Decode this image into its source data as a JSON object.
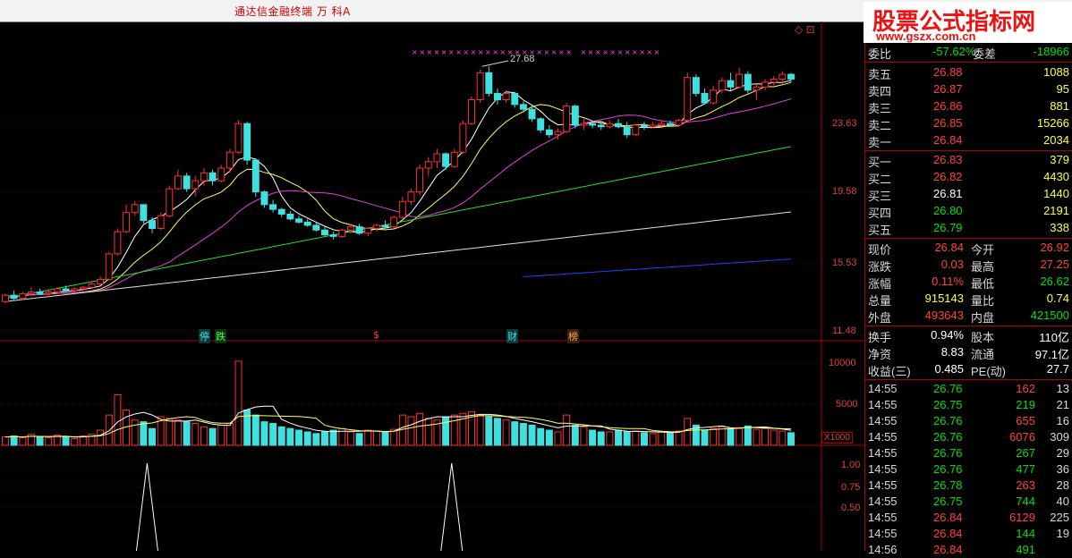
{
  "app": {
    "title": "通达信金融终端    万  科A"
  },
  "watermark": {
    "line1": "股票公式指标网",
    "line2": "www.gszx.com.cn"
  },
  "chart": {
    "corner_icons": "◇ ⊡",
    "max_annotation": "27.68",
    "price_axis": [
      "23.63",
      "19.58",
      "15.53",
      "11.48"
    ],
    "volume_axis": [
      "10000",
      "5000"
    ],
    "volume_unit": "X1000",
    "indicator_axis": [
      "1.00",
      "0.75",
      "0.50"
    ],
    "events": [
      {
        "label": "停",
        "color": "#40e0e0"
      },
      {
        "label": "跌",
        "color": "#40ff40"
      },
      {
        "label": "$",
        "color": "#ff4040"
      },
      {
        "label": "财",
        "color": "#40e0e0"
      },
      {
        "label": "榜",
        "color": "#ffa040"
      }
    ]
  },
  "orderbook": {
    "header": {
      "ratio_label": "委比",
      "ratio_value": "-57.62%",
      "diff_label": "委差",
      "diff_value": "-18966"
    },
    "sell": [
      {
        "label": "卖五",
        "price": "26.88",
        "vol": "1088"
      },
      {
        "label": "卖四",
        "price": "26.87",
        "vol": "95"
      },
      {
        "label": "卖三",
        "price": "26.86",
        "vol": "881"
      },
      {
        "label": "卖二",
        "price": "26.85",
        "vol": "15266"
      },
      {
        "label": "卖一",
        "price": "26.84",
        "vol": "2034"
      }
    ],
    "buy": [
      {
        "label": "买一",
        "price": "26.83",
        "vol": "379"
      },
      {
        "label": "买二",
        "price": "26.82",
        "vol": "4430"
      },
      {
        "label": "买三",
        "price": "26.81",
        "vol": "1440"
      },
      {
        "label": "买四",
        "price": "26.80",
        "vol": "2191"
      },
      {
        "label": "买五",
        "price": "26.79",
        "vol": "338"
      }
    ]
  },
  "quote": {
    "rows": [
      {
        "l1": "现价",
        "v1": "26.84",
        "l2": "今开",
        "v2": "26.92"
      },
      {
        "l1": "涨跌",
        "v1": "0.03",
        "l2": "最高",
        "v2": "27.25"
      },
      {
        "l1": "涨幅",
        "v1": "0.11%",
        "l2": "最低",
        "v2": "26.62"
      },
      {
        "l1": "总量",
        "v1": "915143",
        "l2": "量比",
        "v2": "0.74"
      },
      {
        "l1": "外盘",
        "v1": "493643",
        "l2": "内盘",
        "v2": "421500"
      }
    ]
  },
  "fundamentals": {
    "rows": [
      {
        "l1": "换手",
        "v1": "0.94%",
        "l2": "股本",
        "v2": "110亿"
      },
      {
        "l1": "净资",
        "v1": "8.83",
        "l2": "流通",
        "v2": "97.1亿"
      },
      {
        "l1": "收益(三)",
        "v1": "0.485",
        "l2": "PE(动)",
        "v2": "27.7"
      }
    ]
  },
  "ticks": [
    {
      "time": "14:55",
      "price": "26.76",
      "vol": "162",
      "cnt": "13",
      "pc": "g",
      "vc": "r"
    },
    {
      "time": "14:55",
      "price": "26.75",
      "vol": "219",
      "cnt": "21",
      "pc": "g",
      "vc": "g"
    },
    {
      "time": "14:55",
      "price": "26.76",
      "vol": "655",
      "cnt": "16",
      "pc": "g",
      "vc": "r"
    },
    {
      "time": "14:55",
      "price": "26.76",
      "vol": "6076",
      "cnt": "309",
      "pc": "g",
      "vc": "r"
    },
    {
      "time": "14:55",
      "price": "26.76",
      "vol": "267",
      "cnt": "29",
      "pc": "g",
      "vc": "g"
    },
    {
      "time": "14:55",
      "price": "26.76",
      "vol": "477",
      "cnt": "36",
      "pc": "g",
      "vc": "g"
    },
    {
      "time": "14:55",
      "price": "26.78",
      "vol": "263",
      "cnt": "28",
      "pc": "g",
      "vc": "r"
    },
    {
      "time": "14:55",
      "price": "26.75",
      "vol": "744",
      "cnt": "40",
      "pc": "g",
      "vc": "g"
    },
    {
      "time": "14:55",
      "price": "26.84",
      "vol": "6129",
      "cnt": "225",
      "pc": "r",
      "vc": "r"
    },
    {
      "time": "14:55",
      "price": "26.84",
      "vol": "144",
      "cnt": "19",
      "pc": "r",
      "vc": "g"
    },
    {
      "time": "14:56",
      "price": "26.84",
      "vol": "491",
      "cnt": "",
      "pc": "r",
      "vc": "g"
    }
  ],
  "colors": {
    "up": "#ff3030",
    "down": "#40e0e0",
    "ma5": "#ffffff",
    "ma10": "#ffff60",
    "ma20": "#e040e0",
    "ma60": "#20e020",
    "ma120": "#e0e0e0",
    "ma250": "#2040ff",
    "grid": "#700000"
  },
  "chart_data": {
    "type": "candlestick",
    "candles": [
      [
        12.9,
        13.4,
        12.8,
        13.3
      ],
      [
        13.3,
        13.6,
        13.0,
        13.1
      ],
      [
        13.1,
        13.5,
        13.0,
        13.4
      ],
      [
        13.4,
        13.8,
        13.3,
        13.5
      ],
      [
        13.5,
        13.7,
        13.3,
        13.4
      ],
      [
        13.4,
        13.6,
        13.2,
        13.5
      ],
      [
        13.5,
        13.8,
        13.4,
        13.7
      ],
      [
        13.7,
        13.9,
        13.5,
        13.6
      ],
      [
        13.6,
        13.8,
        13.4,
        13.7
      ],
      [
        13.7,
        13.9,
        13.5,
        13.8
      ],
      [
        13.8,
        14.2,
        13.7,
        14.0
      ],
      [
        14.0,
        14.5,
        13.9,
        14.3
      ],
      [
        14.3,
        16.0,
        14.2,
        15.9
      ],
      [
        15.9,
        17.5,
        15.8,
        17.3
      ],
      [
        17.3,
        19.0,
        17.2,
        18.5
      ],
      [
        18.5,
        19.2,
        18.3,
        19.0
      ],
      [
        19.0,
        19.0,
        17.8,
        18.0
      ],
      [
        18.0,
        18.2,
        17.2,
        17.5
      ],
      [
        17.5,
        18.5,
        17.4,
        18.3
      ],
      [
        18.3,
        20.2,
        18.2,
        20.0
      ],
      [
        20.0,
        21.2,
        19.9,
        20.8
      ],
      [
        20.8,
        21.0,
        19.8,
        20.0
      ],
      [
        20.0,
        20.8,
        19.5,
        20.5
      ],
      [
        20.5,
        21.3,
        20.2,
        21.0
      ],
      [
        21.0,
        21.2,
        20.2,
        20.5
      ],
      [
        20.5,
        21.5,
        20.4,
        21.3
      ],
      [
        21.3,
        22.5,
        21.0,
        22.3
      ],
      [
        22.3,
        24.3,
        22.2,
        24.1
      ],
      [
        24.1,
        24.2,
        21.5,
        21.8
      ],
      [
        21.8,
        21.9,
        19.5,
        19.8
      ],
      [
        19.8,
        19.9,
        18.8,
        19.0
      ],
      [
        19.0,
        19.3,
        18.5,
        18.7
      ],
      [
        18.7,
        18.8,
        18.2,
        18.4
      ],
      [
        18.4,
        18.6,
        18.0,
        18.1
      ],
      [
        18.1,
        18.3,
        17.8,
        17.9
      ],
      [
        17.9,
        18.1,
        17.6,
        17.7
      ],
      [
        17.7,
        17.9,
        17.3,
        17.4
      ],
      [
        17.4,
        17.6,
        17.0,
        17.1
      ],
      [
        17.1,
        17.3,
        16.8,
        17.0
      ],
      [
        17.0,
        17.5,
        16.9,
        17.4
      ],
      [
        17.4,
        17.8,
        17.2,
        17.6
      ],
      [
        17.6,
        17.8,
        17.1,
        17.2
      ],
      [
        17.2,
        17.6,
        17.0,
        17.5
      ],
      [
        17.5,
        17.8,
        17.3,
        17.7
      ],
      [
        17.7,
        18.0,
        17.5,
        17.6
      ],
      [
        17.6,
        18.3,
        17.5,
        18.2
      ],
      [
        18.2,
        19.5,
        18.1,
        19.2
      ],
      [
        19.2,
        20.0,
        19.0,
        19.8
      ],
      [
        19.8,
        21.5,
        19.6,
        21.3
      ],
      [
        21.3,
        22.0,
        20.8,
        21.7
      ],
      [
        21.7,
        22.5,
        21.3,
        22.2
      ],
      [
        22.2,
        22.3,
        21.2,
        21.4
      ],
      [
        21.4,
        22.5,
        21.3,
        22.3
      ],
      [
        22.3,
        24.3,
        22.2,
        24.1
      ],
      [
        24.1,
        25.8,
        24.0,
        25.6
      ],
      [
        25.6,
        27.5,
        25.4,
        27.3
      ],
      [
        27.3,
        27.7,
        25.8,
        26.0
      ],
      [
        26.0,
        26.3,
        25.3,
        25.6
      ],
      [
        25.6,
        26.2,
        25.4,
        26.0
      ],
      [
        26.0,
        26.1,
        25.1,
        25.3
      ],
      [
        25.3,
        25.5,
        24.8,
        25.0
      ],
      [
        25.0,
        25.2,
        24.2,
        24.4
      ],
      [
        24.4,
        24.5,
        23.5,
        23.7
      ],
      [
        23.7,
        24.0,
        23.2,
        23.4
      ],
      [
        23.4,
        23.8,
        23.1,
        23.6
      ],
      [
        23.6,
        25.4,
        23.5,
        25.2
      ],
      [
        25.2,
        25.3,
        23.8,
        24.0
      ],
      [
        24.0,
        24.4,
        23.7,
        24.1
      ],
      [
        24.1,
        24.3,
        23.8,
        24.0
      ],
      [
        24.0,
        24.2,
        23.7,
        23.9
      ],
      [
        23.9,
        24.3,
        23.8,
        24.1
      ],
      [
        24.1,
        24.4,
        23.8,
        23.9
      ],
      [
        23.9,
        24.2,
        23.2,
        23.4
      ],
      [
        23.4,
        24.1,
        23.3,
        24.0
      ],
      [
        24.0,
        24.2,
        23.7,
        23.9
      ],
      [
        23.9,
        24.2,
        23.8,
        24.0
      ],
      [
        24.0,
        24.3,
        23.8,
        24.1
      ],
      [
        24.1,
        24.3,
        23.9,
        24.0
      ],
      [
        24.0,
        24.4,
        23.9,
        24.3
      ],
      [
        24.3,
        27.3,
        24.2,
        27.0
      ],
      [
        27.0,
        27.2,
        25.8,
        26.0
      ],
      [
        26.0,
        26.3,
        25.3,
        25.4
      ],
      [
        25.4,
        26.5,
        25.3,
        26.2
      ],
      [
        26.2,
        27.0,
        26.0,
        26.8
      ],
      [
        26.8,
        27.3,
        26.2,
        26.4
      ],
      [
        26.4,
        27.6,
        26.3,
        27.2
      ],
      [
        27.2,
        27.4,
        26.0,
        26.2
      ],
      [
        26.2,
        26.6,
        25.6,
        26.4
      ],
      [
        26.4,
        26.9,
        26.2,
        26.7
      ],
      [
        26.7,
        27.1,
        26.5,
        26.9
      ],
      [
        26.9,
        27.4,
        26.6,
        27.2
      ],
      [
        27.2,
        27.3,
        26.7,
        26.9
      ]
    ],
    "volumes": [
      1.0,
      1.1,
      0.9,
      1.3,
      1.0,
      0.9,
      1.2,
      1.0,
      0.8,
      1.1,
      1.3,
      1.8,
      3.6,
      6.0,
      4.2,
      3.0,
      2.8,
      2.0,
      3.4,
      3.2,
      3.0,
      2.8,
      2.6,
      2.2,
      2.0,
      2.4,
      2.6,
      10.0,
      4.2,
      3.6,
      2.8,
      2.6,
      2.2,
      2.0,
      1.8,
      1.6,
      1.4,
      1.6,
      1.8,
      2.0,
      1.6,
      1.4,
      1.8,
      1.7,
      1.6,
      1.9,
      3.6,
      3.4,
      3.8,
      3.2,
      3.0,
      3.4,
      3.6,
      3.8,
      4.0,
      3.6,
      3.4,
      3.2,
      3.0,
      2.8,
      2.6,
      2.4,
      2.0,
      1.8,
      1.6,
      3.6,
      2.4,
      2.2,
      1.8,
      1.6,
      1.6,
      1.8,
      1.6,
      1.7,
      1.5,
      1.4,
      1.6,
      1.5,
      1.7,
      3.2,
      2.4,
      1.8,
      2.0,
      2.2,
      2.0,
      2.1,
      2.3,
      1.9,
      2.0,
      1.8,
      1.7,
      1.5
    ],
    "ylim": [
      11.48,
      27.68
    ],
    "volume_max": 10000,
    "indicator_spikes": [
      0.186,
      0.571
    ]
  }
}
